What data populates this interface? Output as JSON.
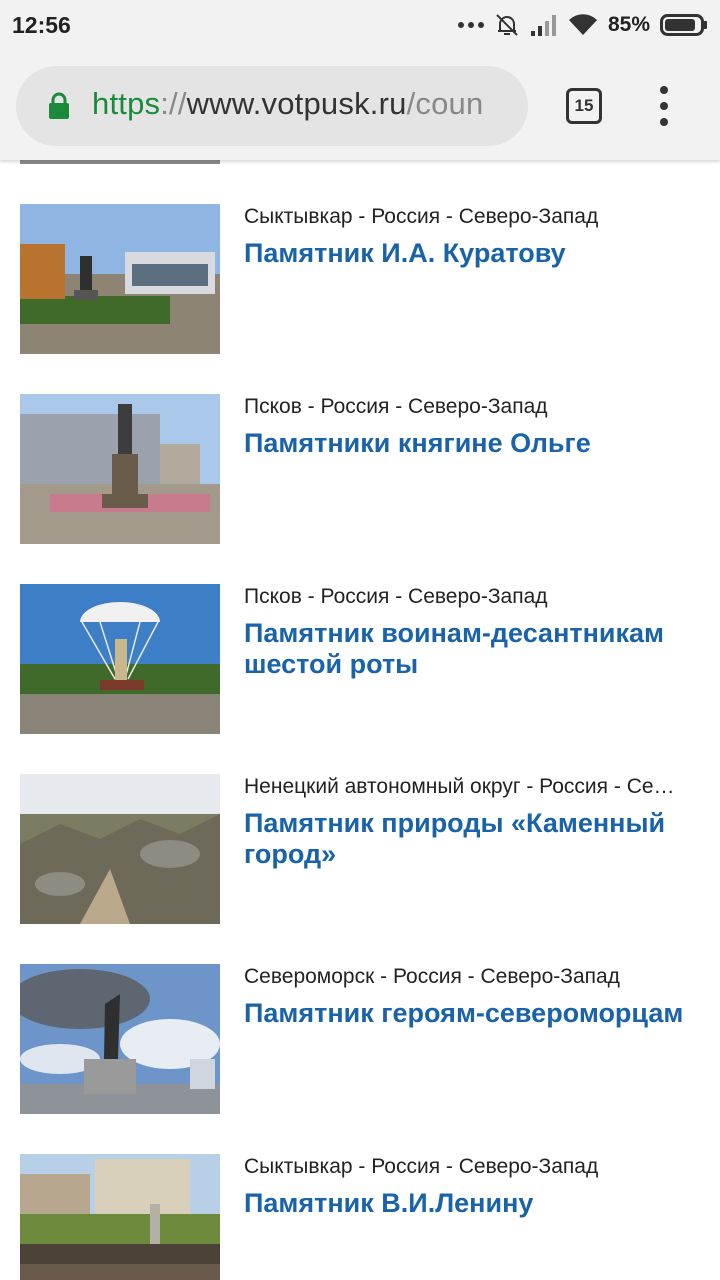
{
  "status_bar": {
    "time": "12:56",
    "battery": "85%",
    "icons": [
      "more-dots-icon",
      "alarm-off-icon",
      "signal-icon",
      "wifi-icon",
      "battery-icon"
    ]
  },
  "browser": {
    "url_scheme": "https",
    "url_sep": "://",
    "url_host": "www.votpusk.ru",
    "url_path": "/coun",
    "tab_count": "15"
  },
  "items": [
    {
      "region": "Сыктывкар - Россия - Северо-Запад",
      "title": "Памятник И.А. Куратову"
    },
    {
      "region": "Псков - Россия - Северо-Запад",
      "title": "Памятники княгине Ольге"
    },
    {
      "region": "Псков - Россия - Северо-Запад",
      "title": "Памятник воинам-десантникам шестой роты"
    },
    {
      "region": "Ненецкий автономный округ - Россия - Се…",
      "title": "Памятник природы «Каменный город»"
    },
    {
      "region": "Североморск - Россия - Северо-Запад",
      "title": "Памятник героям-североморцам"
    },
    {
      "region": "Сыктывкар - Россия - Северо-Запад",
      "title": "Памятник В.И.Ленину"
    }
  ]
}
